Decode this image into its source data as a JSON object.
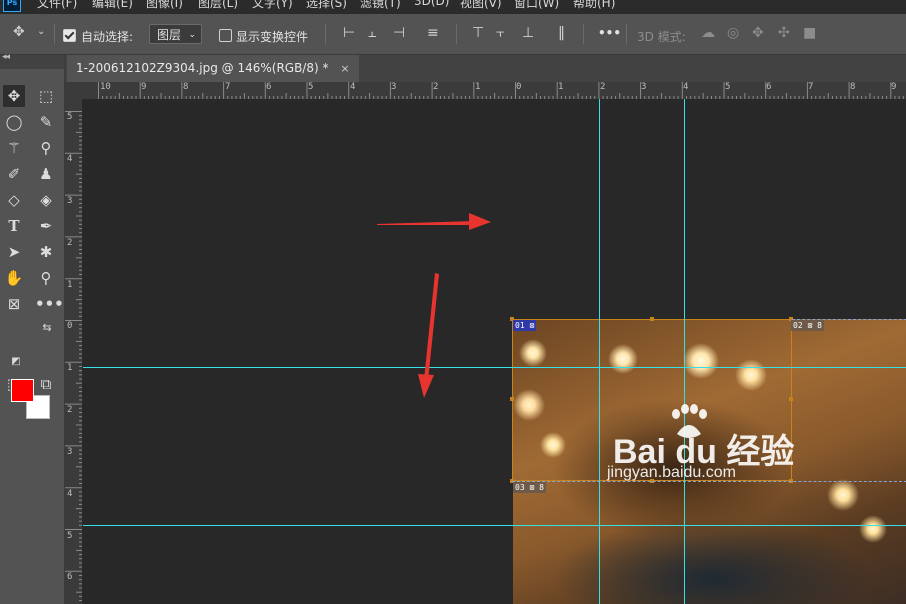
{
  "menubar": {
    "items": [
      "文件(F)",
      "编辑(E)",
      "图像(I)",
      "图层(L)",
      "文字(Y)",
      "选择(S)",
      "滤镜(T)",
      "3D(D)",
      "视图(V)",
      "窗口(W)",
      "帮助(H)"
    ]
  },
  "options_bar": {
    "auto_select_label": "自动选择:",
    "auto_select_checked": true,
    "layer_dropdown_value": "图层",
    "show_transform_label": "显示变换控件",
    "show_transform_checked": false,
    "more_label": "•••",
    "mode_3d_label": "3D 模式:"
  },
  "toolbar": {
    "collapse_label": "◂◂",
    "tools": [
      [
        "move-tool-icon",
        "marquee-tool-icon"
      ],
      [
        "lasso-tool-icon",
        "quick-select-tool-icon"
      ],
      [
        "magic-wand-tool-icon",
        "eyedropper-tool-icon"
      ],
      [
        "brush-tool-icon",
        "stamp-tool-icon"
      ],
      [
        "eraser-tool-icon",
        "paint-bucket-tool-icon"
      ],
      [
        "type-tool-icon",
        "pen-tool-icon"
      ],
      [
        "path-select-tool-icon",
        "custom-shape-tool-icon"
      ],
      [
        "hand-tool-icon",
        "zoom-tool-icon"
      ],
      [
        "frame-tool-icon",
        "more-tools-icon"
      ]
    ],
    "foreground_color": "#ff0000",
    "background_color": "#ffffff"
  },
  "document": {
    "tab_title": "1-200612102Z9304.jpg @ 146%(RGB/8) *",
    "tab_close": "×"
  },
  "rulers": {
    "top_labels": [
      "10",
      "9",
      "8",
      "7",
      "6",
      "5",
      "4",
      "3",
      "2",
      "1",
      "0",
      "1",
      "2",
      "3",
      "4",
      "5",
      "6",
      "7",
      "8",
      "9"
    ],
    "left_labels": [
      "5",
      "4",
      "3",
      "2",
      "1",
      "0",
      "1",
      "2",
      "3",
      "4",
      "5",
      "6"
    ]
  },
  "slices": {
    "tag1": "01 ⊠",
    "tag2": "02 ⊠ 8",
    "tag3": "03 ⊠ 8"
  },
  "watermark": {
    "main": "Bai du 经验",
    "sub": "jingyan.baidu.com"
  },
  "colors": {
    "guide": "#36e0e6",
    "slice_border": "#c68419",
    "arrow": "#e8342f",
    "active_slice_tag": "#2f3aa8"
  }
}
